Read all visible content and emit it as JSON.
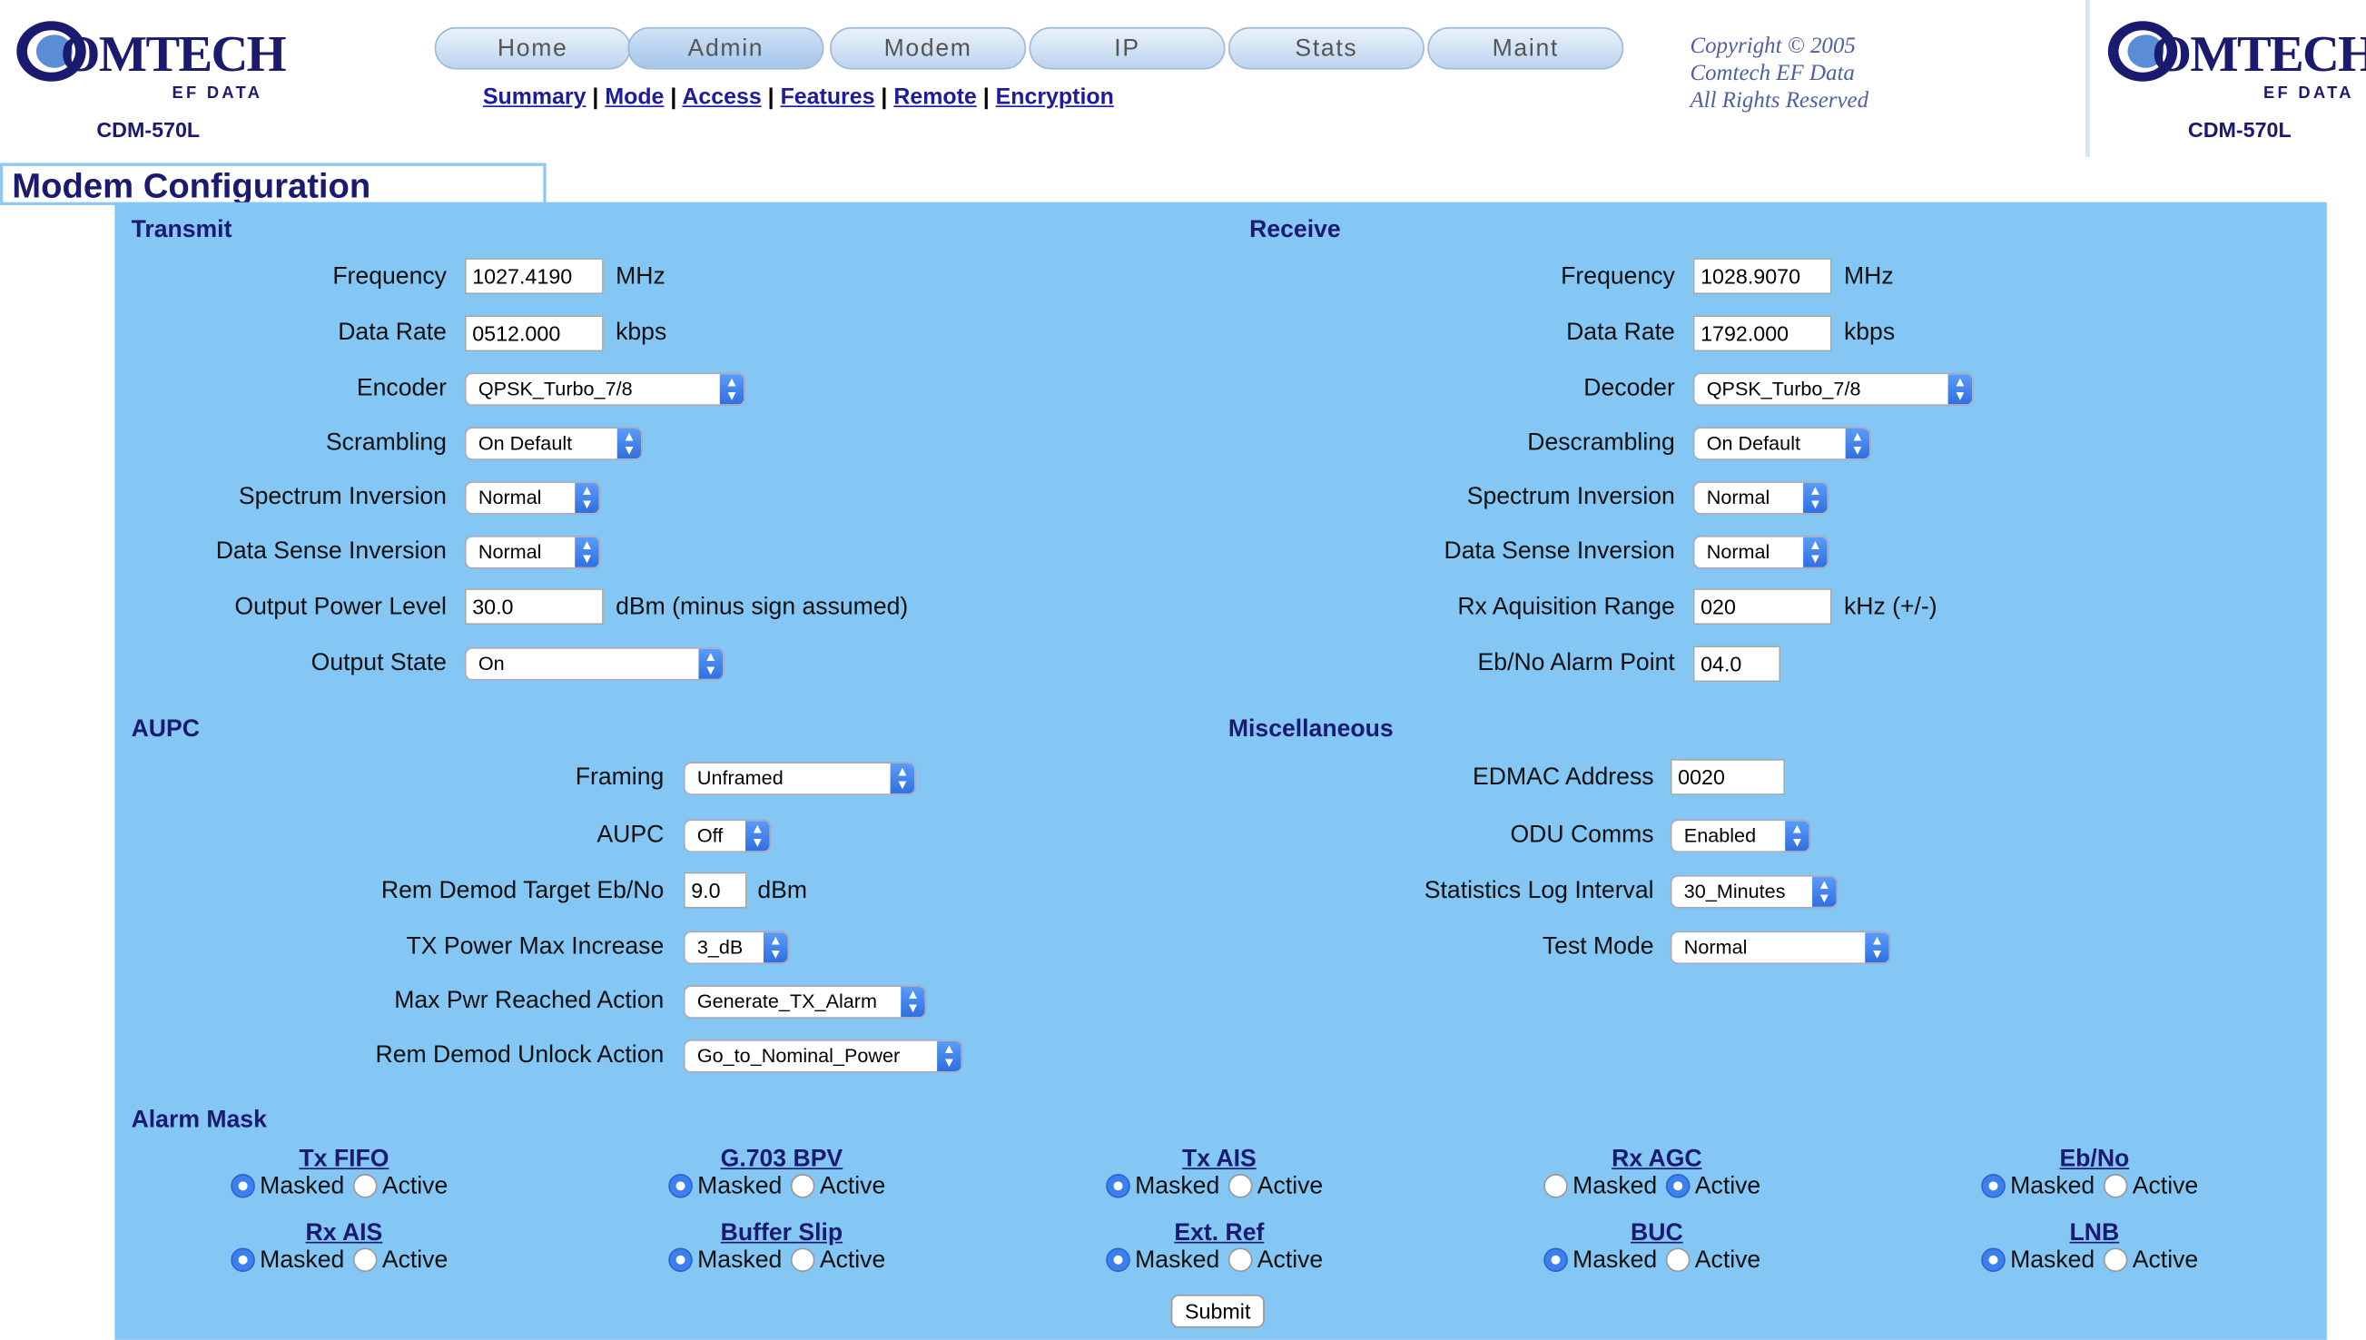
{
  "brand": {
    "name": "OMTECH",
    "sub": "EF DATA",
    "model": "CDM-570L"
  },
  "nav": {
    "tabs": [
      "Home",
      "Admin",
      "Modem",
      "IP",
      "Stats",
      "Maint"
    ],
    "sublinks": [
      "Summary",
      "Mode",
      "Access",
      "Features",
      "Remote",
      "Encryption"
    ],
    "sep": "|"
  },
  "copyright": [
    "Copyright © 2005",
    "Comtech EF Data",
    "All Rights Reserved"
  ],
  "page_title": "Modem Configuration",
  "transmit": {
    "title": "Transmit",
    "frequency": {
      "label": "Frequency",
      "value": "1027.4190",
      "unit": "MHz"
    },
    "data_rate": {
      "label": "Data Rate",
      "value": "0512.000",
      "unit": "kbps"
    },
    "encoder": {
      "label": "Encoder",
      "value": "QPSK_Turbo_7/8"
    },
    "scrambling": {
      "label": "Scrambling",
      "value": "On Default"
    },
    "spectrum_inversion": {
      "label": "Spectrum Inversion",
      "value": "Normal"
    },
    "data_sense_inversion": {
      "label": "Data Sense Inversion",
      "value": "Normal"
    },
    "output_power_level": {
      "label": "Output Power Level",
      "value": "30.0",
      "unit": "dBm (minus sign assumed)"
    },
    "output_state": {
      "label": "Output State",
      "value": "On"
    }
  },
  "receive": {
    "title": "Receive",
    "frequency": {
      "label": "Frequency",
      "value": "1028.9070",
      "unit": "MHz"
    },
    "data_rate": {
      "label": "Data Rate",
      "value": "1792.000",
      "unit": "kbps"
    },
    "decoder": {
      "label": "Decoder",
      "value": "QPSK_Turbo_7/8"
    },
    "descrambling": {
      "label": "Descrambling",
      "value": "On Default"
    },
    "spectrum_inversion": {
      "label": "Spectrum Inversion",
      "value": "Normal"
    },
    "data_sense_inversion": {
      "label": "Data Sense Inversion",
      "value": "Normal"
    },
    "rx_acq_range": {
      "label": "Rx Aquisition Range",
      "value": "020",
      "unit": "kHz (+/-)"
    },
    "ebno_alarm": {
      "label": "Eb/No Alarm Point",
      "value": "04.0"
    }
  },
  "aupc": {
    "title": "AUPC",
    "framing": {
      "label": "Framing",
      "value": "Unframed"
    },
    "aupc": {
      "label": "AUPC",
      "value": "Off"
    },
    "target": {
      "label": "Rem Demod Target Eb/No",
      "value": "9.0",
      "unit": "dBm"
    },
    "max_increase": {
      "label": "TX Power Max Increase",
      "value": "3_dB"
    },
    "max_reached": {
      "label": "Max Pwr Reached Action",
      "value": "Generate_TX_Alarm"
    },
    "unlock": {
      "label": "Rem Demod Unlock Action",
      "value": "Go_to_Nominal_Power"
    }
  },
  "misc": {
    "title": "Miscellaneous",
    "edmac": {
      "label": "EDMAC Address",
      "value": "0020"
    },
    "odu": {
      "label": "ODU Comms",
      "value": "Enabled"
    },
    "stats": {
      "label": "Statistics Log Interval",
      "value": "30_Minutes"
    },
    "test": {
      "label": "Test Mode",
      "value": "Normal"
    }
  },
  "alarm_mask": {
    "title": "Alarm Mask",
    "masked": "Masked",
    "active": "Active",
    "items": [
      {
        "name": "Tx FIFO",
        "state": "Masked"
      },
      {
        "name": "G.703 BPV",
        "state": "Masked"
      },
      {
        "name": "Tx AIS",
        "state": "Masked"
      },
      {
        "name": "Rx AGC",
        "state": "Active"
      },
      {
        "name": "Eb/No",
        "state": "Masked"
      },
      {
        "name": "Rx AIS",
        "state": "Masked"
      },
      {
        "name": "Buffer Slip",
        "state": "Masked"
      },
      {
        "name": "Ext. Ref",
        "state": "Masked"
      },
      {
        "name": "BUC",
        "state": "Masked"
      },
      {
        "name": "LNB",
        "state": "Masked"
      }
    ]
  },
  "submit": "Submit"
}
